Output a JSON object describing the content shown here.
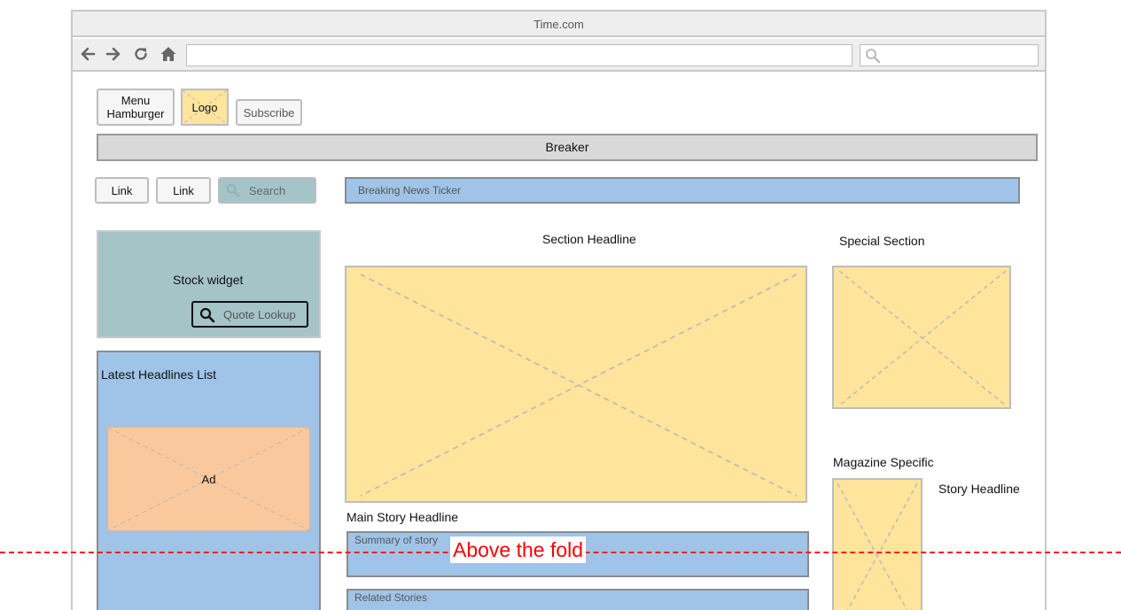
{
  "browser": {
    "title": "Time.com",
    "url": "",
    "search": ""
  },
  "header": {
    "menu_label": "Menu\nHamburger",
    "logo_label": "Logo",
    "subscribe_label": "Subscribe",
    "breaker_label": "Breaker"
  },
  "nav": {
    "link1": "Link",
    "link2": "Link",
    "search_label": "Search"
  },
  "ticker": {
    "label": "Breaking News Ticker"
  },
  "sidebar": {
    "stock_label": "Stock widget",
    "quote_label": "Quote Lookup",
    "latest_label": "Latest Headlines List",
    "ad_label": "Ad"
  },
  "main": {
    "section_headline": "Section Headline",
    "main_story_headline": "Main Story Headline",
    "summary_label": "Summary of story",
    "related_label": "Related Stories"
  },
  "right": {
    "special_section": "Special Section",
    "magazine_specific": "Magazine Specific",
    "story_headline": "Story Headline"
  },
  "annotation": {
    "fold_label": "Above the fold",
    "fold_color": "#ff1a1a"
  },
  "colors": {
    "placeholder_yellow": "#ffe49c",
    "ad_orange": "#f9c89c",
    "block_blue": "#a0c4e8",
    "stock_teal": "#a4c4c8"
  }
}
